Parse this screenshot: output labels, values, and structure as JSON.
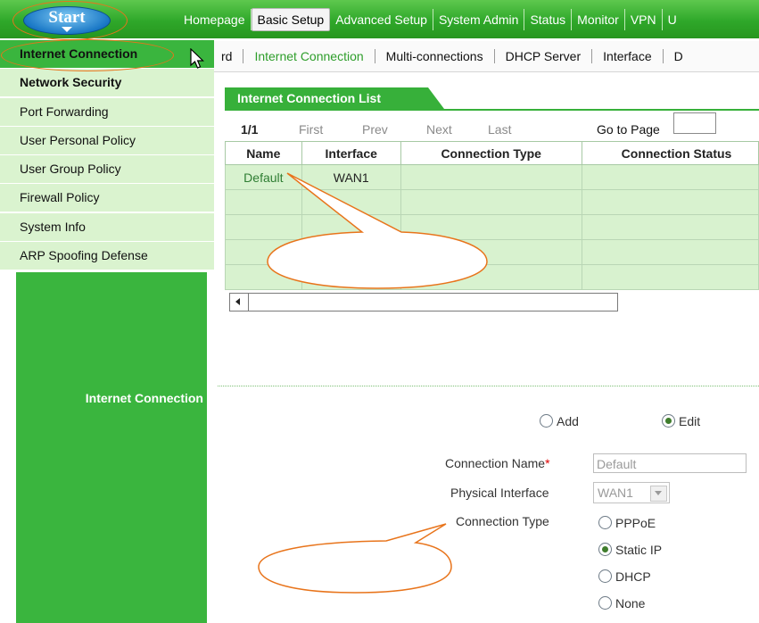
{
  "start_button": {
    "label": "Start"
  },
  "top_nav": [
    {
      "label": "Homepage",
      "active": false
    },
    {
      "label": "Basic Setup",
      "active": true
    },
    {
      "label": "Advanced Setup",
      "active": false
    },
    {
      "label": "System Admin",
      "active": false
    },
    {
      "label": "Status",
      "active": false
    },
    {
      "label": "Monitor",
      "active": false
    },
    {
      "label": "VPN",
      "active": false
    },
    {
      "label": "U",
      "active": false
    }
  ],
  "sub_nav": [
    {
      "label": "rd",
      "active": false
    },
    {
      "label": "Internet Connection",
      "active": true
    },
    {
      "label": "Multi-connections",
      "active": false
    },
    {
      "label": "DHCP Server",
      "active": false
    },
    {
      "label": "Interface",
      "active": false
    },
    {
      "label": "D",
      "active": false
    }
  ],
  "sidebar": {
    "items": [
      {
        "label": "Internet Connection",
        "bold": true
      },
      {
        "label": "Network Security",
        "bold": true
      },
      {
        "label": "Port Forwarding",
        "bold": false
      },
      {
        "label": "User Personal Policy",
        "bold": false
      },
      {
        "label": "User Group Policy",
        "bold": false
      },
      {
        "label": "Firewall Policy",
        "bold": false
      },
      {
        "label": "System Info",
        "bold": false
      },
      {
        "label": "ARP Spoofing Defense",
        "bold": false
      }
    ],
    "panel_label": "Internet Connection"
  },
  "list": {
    "title": "Internet Connection List",
    "pager": {
      "page": "1/1",
      "first": "First",
      "prev": "Prev",
      "next": "Next",
      "last": "Last",
      "goto_label": "Go to Page",
      "goto_value": ""
    },
    "columns": [
      "Name",
      "Interface",
      "Connection Type",
      "Connection Status"
    ],
    "rows": [
      [
        "Default",
        "WAN1",
        "",
        ""
      ],
      [
        "",
        "",
        "",
        ""
      ],
      [
        "",
        "",
        "",
        ""
      ],
      [
        "",
        "",
        "",
        ""
      ],
      [
        "",
        "",
        "",
        ""
      ]
    ]
  },
  "form": {
    "mode_add": "Add",
    "mode_edit": "Edit",
    "mode_selected": "Edit",
    "connection_name_label": "Connection Name",
    "required_mark": "*",
    "connection_name_value": "Default",
    "physical_interface_label": "Physical Interface",
    "physical_interface_value": "WAN1",
    "connection_type_label": "Connection Type",
    "connection_types": [
      "PPPoE",
      "Static IP",
      "DHCP",
      "None"
    ],
    "connection_type_selected": "Static IP"
  },
  "colors": {
    "brand_green": "#3ab53e",
    "sidebar_item_bg": "#daf3cf",
    "highlight_ring": "#e8741b",
    "start_blue": "#1a78c6"
  }
}
